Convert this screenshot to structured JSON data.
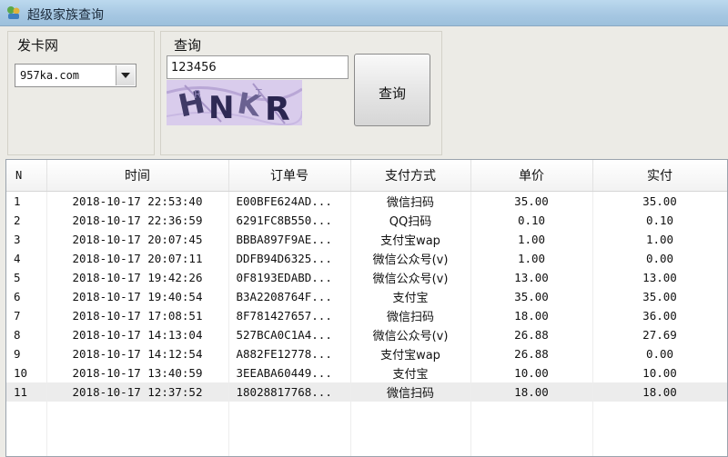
{
  "window": {
    "title": "超级家族查询"
  },
  "provider": {
    "label": "发卡网",
    "selected": "957ka.com"
  },
  "query": {
    "label": "查询",
    "input_value": "123456",
    "captcha_text": "HNKR",
    "button_label": "查询"
  },
  "table": {
    "columns": [
      "N",
      "时间",
      "订单号",
      "支付方式",
      "单价",
      "实付"
    ],
    "rows": [
      [
        "1",
        "2018-10-17 22:53:40",
        "E00BFE624AD...",
        "微信扫码",
        "35.00",
        "35.00"
      ],
      [
        "2",
        "2018-10-17 22:36:59",
        "6291FC8B550...",
        "QQ扫码",
        "0.10",
        "0.10"
      ],
      [
        "3",
        "2018-10-17 20:07:45",
        "BBBA897F9AE...",
        "支付宝wap",
        "1.00",
        "1.00"
      ],
      [
        "4",
        "2018-10-17 20:07:11",
        "DDFB94D6325...",
        "微信公众号(v)",
        "1.00",
        "0.00"
      ],
      [
        "5",
        "2018-10-17 19:42:26",
        "0F8193EDABD...",
        "微信公众号(v)",
        "13.00",
        "13.00"
      ],
      [
        "6",
        "2018-10-17 19:40:54",
        "B3A2208764F...",
        "支付宝",
        "35.00",
        "35.00"
      ],
      [
        "7",
        "2018-10-17 17:08:51",
        "8F781427657...",
        "微信扫码",
        "18.00",
        "36.00"
      ],
      [
        "8",
        "2018-10-17 14:13:04",
        "527BCA0C1A4...",
        "微信公众号(v)",
        "26.88",
        "27.69"
      ],
      [
        "9",
        "2018-10-17 14:12:54",
        "A882FE12778...",
        "支付宝wap",
        "26.88",
        "0.00"
      ],
      [
        "10",
        "2018-10-17 13:40:59",
        "3EEABA60449...",
        "支付宝",
        "10.00",
        "10.00"
      ],
      [
        "11",
        "2018-10-17 12:37:52",
        "18028817768...",
        "微信扫码",
        "18.00",
        "18.00"
      ]
    ],
    "selected_row": 10
  }
}
